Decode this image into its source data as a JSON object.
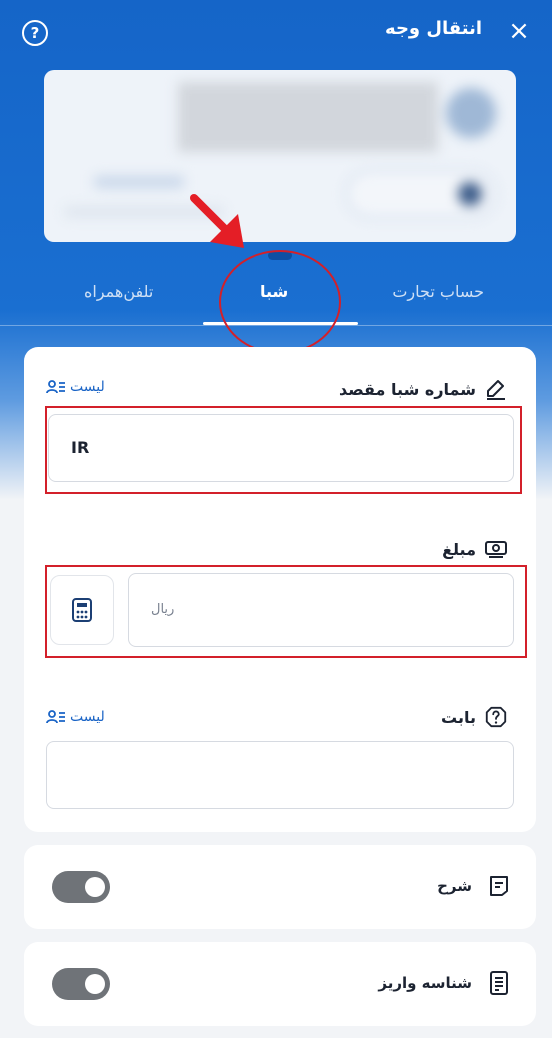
{
  "header": {
    "title": "انتقال وجه",
    "help_icon": "?",
    "close_icon": "×"
  },
  "tabs": [
    {
      "label": "حساب تجارت",
      "active": false
    },
    {
      "label": "شبا",
      "active": true
    },
    {
      "label": "تلفن‌همراه",
      "active": false
    }
  ],
  "form": {
    "iban": {
      "label": "شماره شبا مقصد",
      "prefix": "IR",
      "list_label": "لیست"
    },
    "amount": {
      "label": "مبلغ",
      "unit_placeholder": "ریال"
    },
    "reason": {
      "label": "بابت",
      "list_label": "لیست"
    }
  },
  "toggles": [
    {
      "label": "شرح",
      "on": false
    },
    {
      "label": "شناسه واریز",
      "on": false
    }
  ],
  "colors": {
    "primary": "#1a6fd1",
    "annotation": "#d3202a",
    "link": "#1a64c6"
  }
}
